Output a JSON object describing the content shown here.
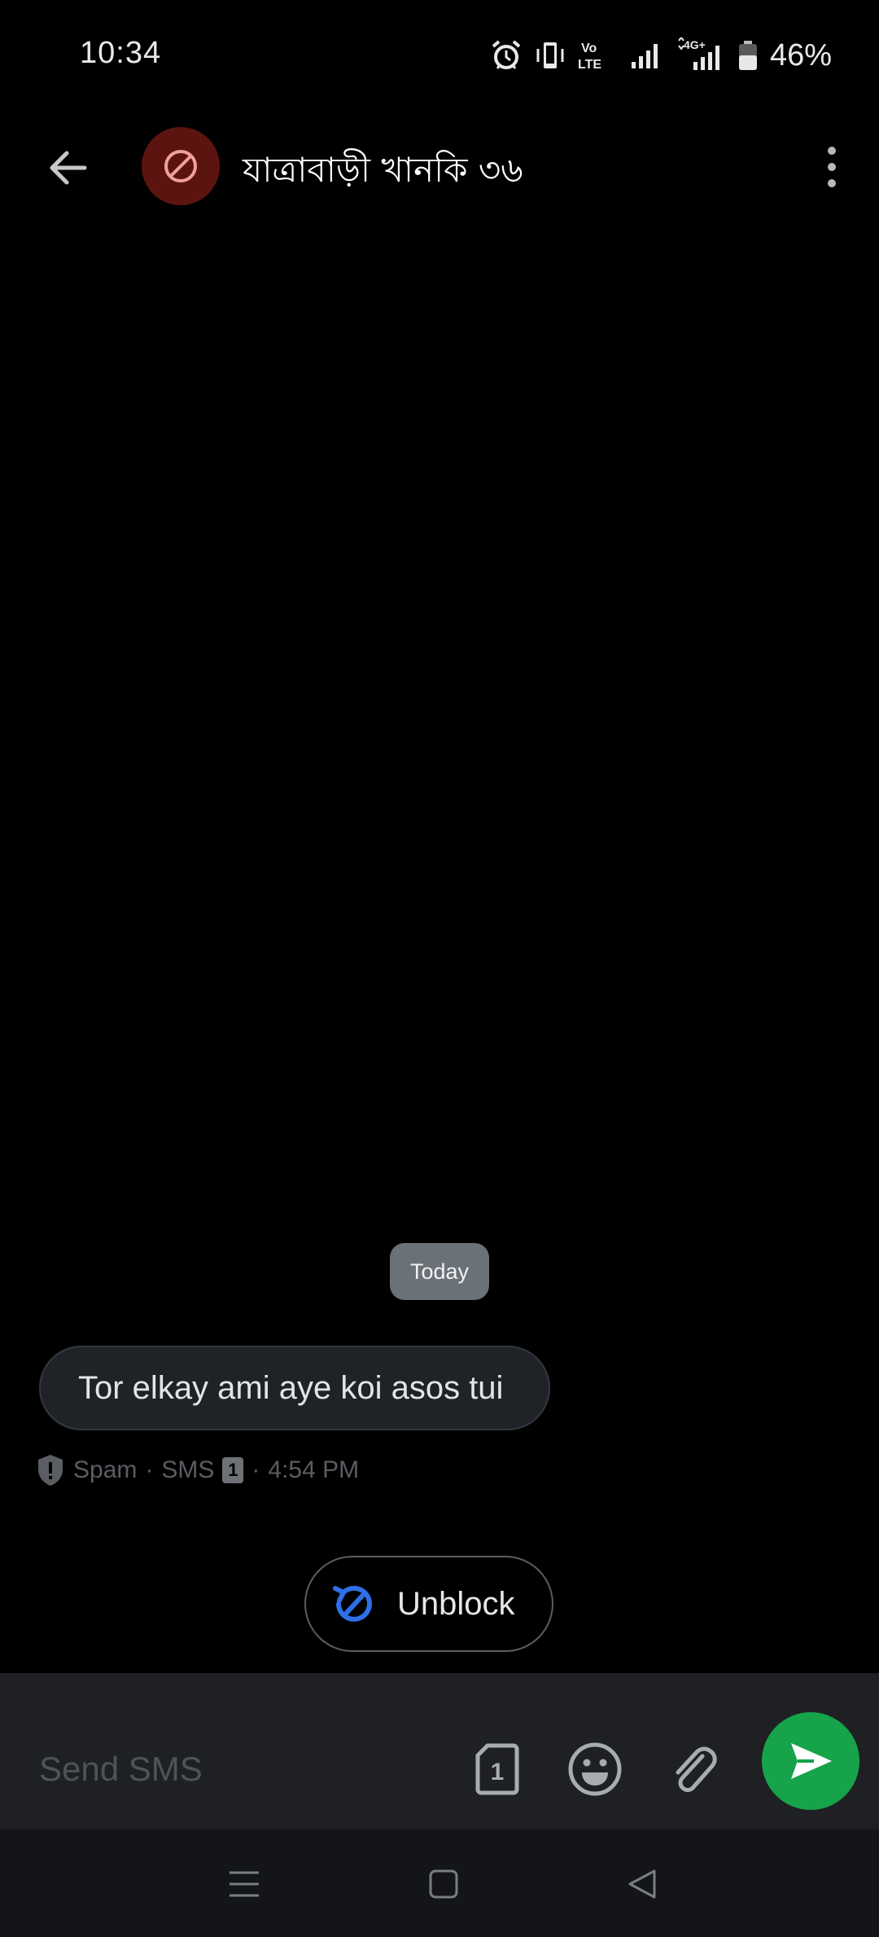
{
  "status_bar": {
    "time": "10:34",
    "battery_percent": "46%",
    "icons": [
      "alarm-icon",
      "vibrate-icon",
      "volte-icon",
      "signal-icon",
      "4g-signal-icon",
      "battery-icon"
    ]
  },
  "header": {
    "contact_name": "যাত্রাবাড়ী খানকি ৩৬",
    "avatar_icon": "blocked-icon",
    "avatar_color": "#5c1410"
  },
  "conversation": {
    "date_chip": "Today",
    "messages": [
      {
        "text": "Tor elkay ami aye koi asos tui",
        "label": "Spam",
        "channel": "SMS",
        "sim": "1",
        "time": "4:54 PM"
      }
    ],
    "separator": "·",
    "unblock_label": "Unblock",
    "unblock_icon_color": "#2f6fe8"
  },
  "compose": {
    "placeholder": "Send SMS",
    "sim_number": "1",
    "send_color": "#16a34a"
  },
  "nav": {
    "icons": [
      "menu-icon",
      "home-icon",
      "back-triangle-icon"
    ]
  }
}
